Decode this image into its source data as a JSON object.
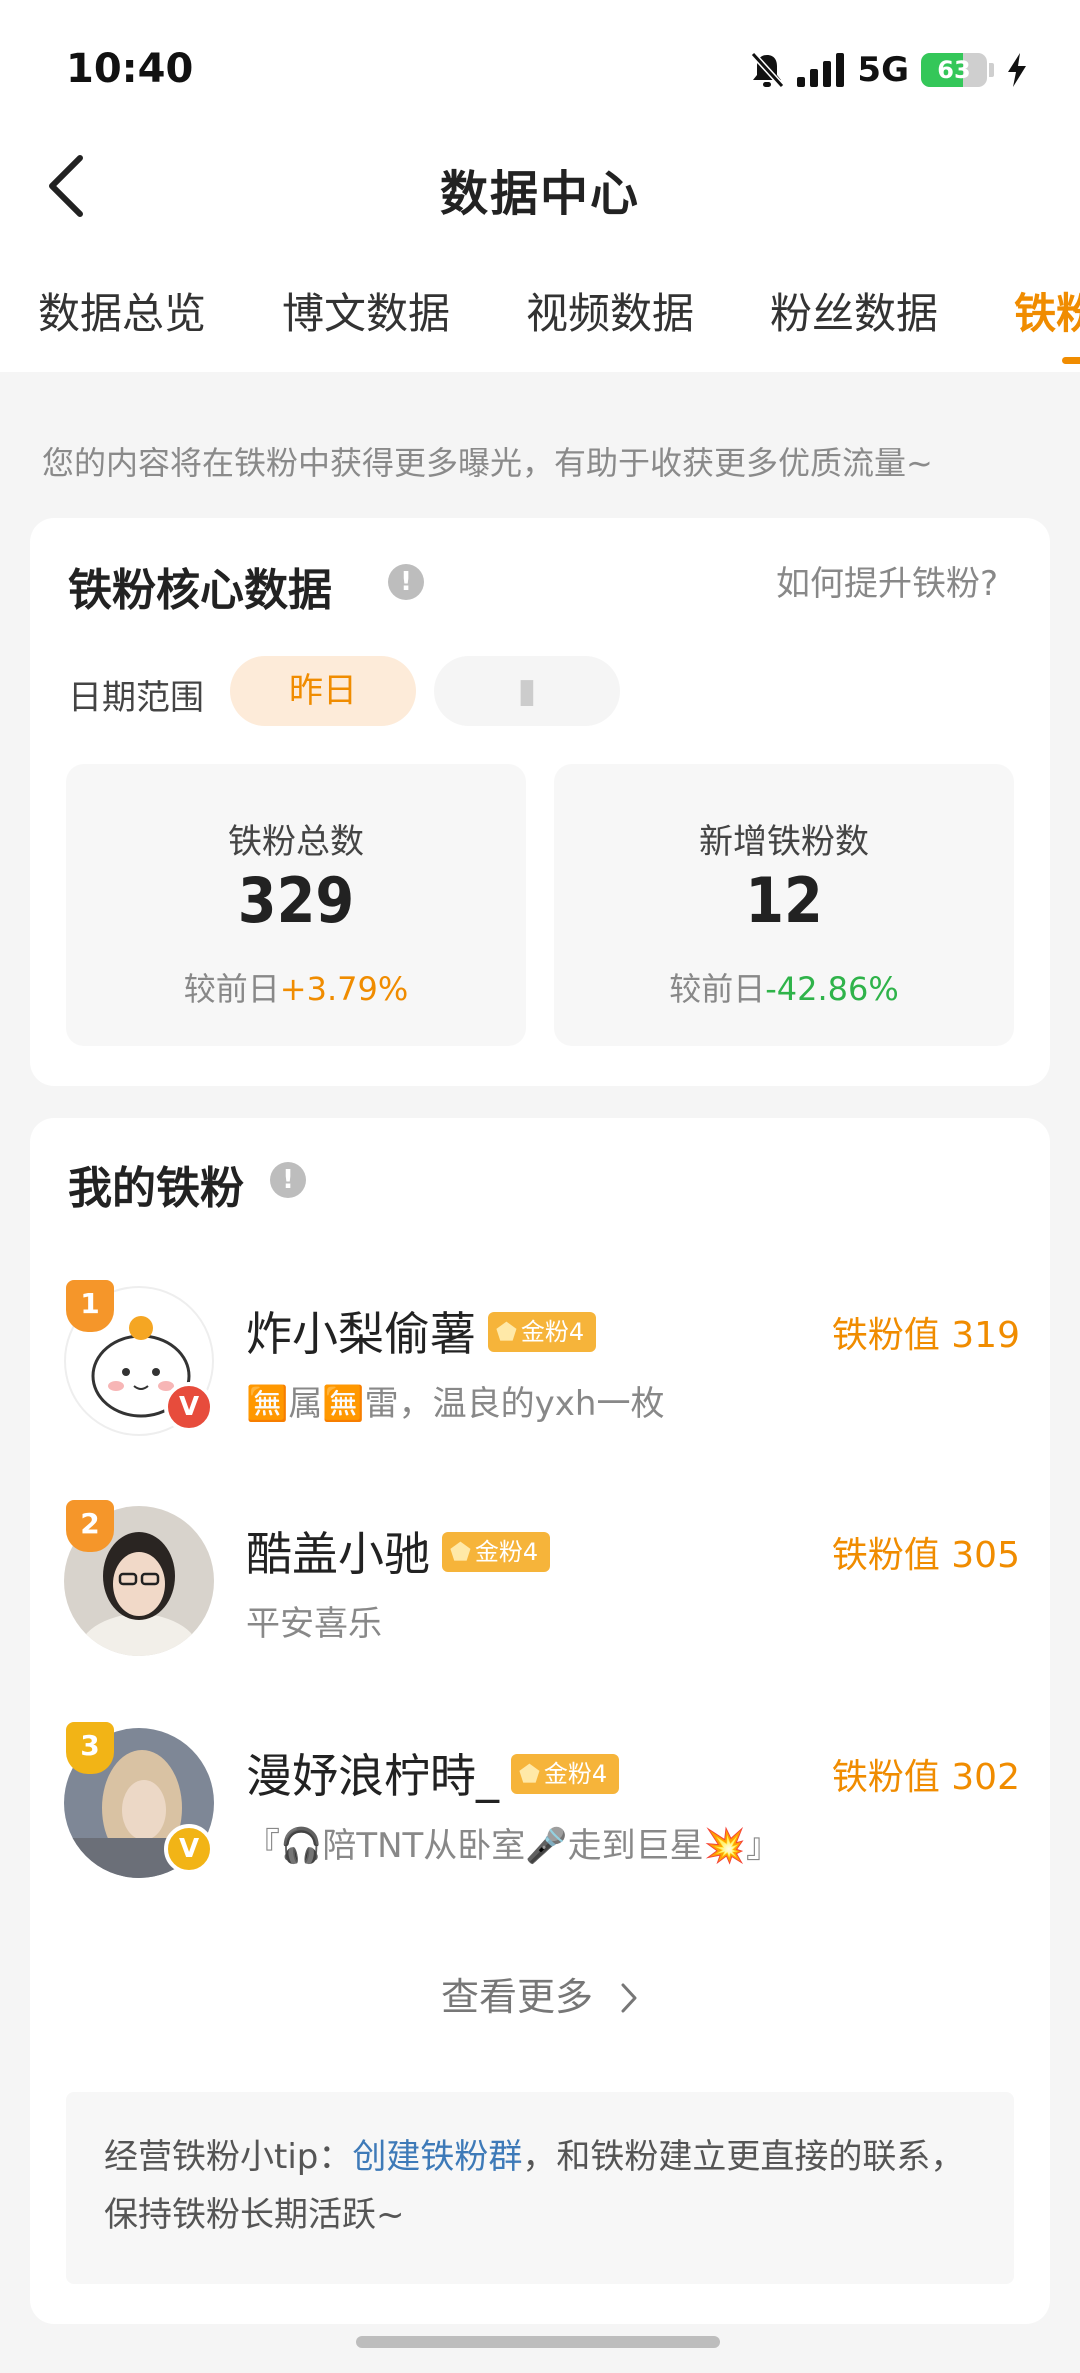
{
  "status_bar": {
    "time": "10:40",
    "network": "5G",
    "battery": "63",
    "battery_level": 0.63,
    "battery_color": "#34c759"
  },
  "header": {
    "title": "数据中心",
    "back_icon": "chevron-left-icon"
  },
  "tabs": [
    {
      "label": "数据总览",
      "active": false
    },
    {
      "label": "博文数据",
      "active": false
    },
    {
      "label": "视频数据",
      "active": false
    },
    {
      "label": "粉丝数据",
      "active": false
    },
    {
      "label": "铁粉",
      "active": true
    }
  ],
  "hint": "您的内容将在铁粉中获得更多曝光，有助于收获更多优质流量~",
  "core": {
    "title": "铁粉核心数据",
    "help_link": "如何提升铁粉?",
    "date_label": "日期范围",
    "date_selected": "昨日",
    "stats": [
      {
        "label": "铁粉总数",
        "value": "329",
        "compare_prefix": "较前日",
        "change": "+3.79%"
      },
      {
        "label": "新增铁粉数",
        "value": "12",
        "compare_prefix": "较前日",
        "change": "-42.86%"
      }
    ]
  },
  "fans": {
    "title": "我的铁粉",
    "items": [
      {
        "rank": "1",
        "name": "炸小梨偷薯",
        "badge": "金粉4",
        "bio": "🈚属🈚雷，温良的yxh一枚",
        "score": "铁粉值 319",
        "verified": "V"
      },
      {
        "rank": "2",
        "name": "酷盖小驰",
        "badge": "金粉4",
        "bio": "平安喜乐",
        "score": "铁粉值 305"
      },
      {
        "rank": "3",
        "name": "漫妤浪柠時_",
        "badge": "金粉4",
        "bio": "『🎧陪TNT从卧室🎤走到巨星💥』",
        "score": "铁粉值 302",
        "verified": "V"
      }
    ],
    "see_more": "查看更多"
  },
  "tip": {
    "prefix": "经营铁粉小tip：",
    "link": "创建铁粉群",
    "suffix": "，和铁粉建立更直接的联系，保持铁粉长期活跃~"
  },
  "colors": {
    "accent": "#f08c00",
    "positive": "#f08c00",
    "negative": "#2fb34a",
    "link": "#3e7ab8"
  }
}
